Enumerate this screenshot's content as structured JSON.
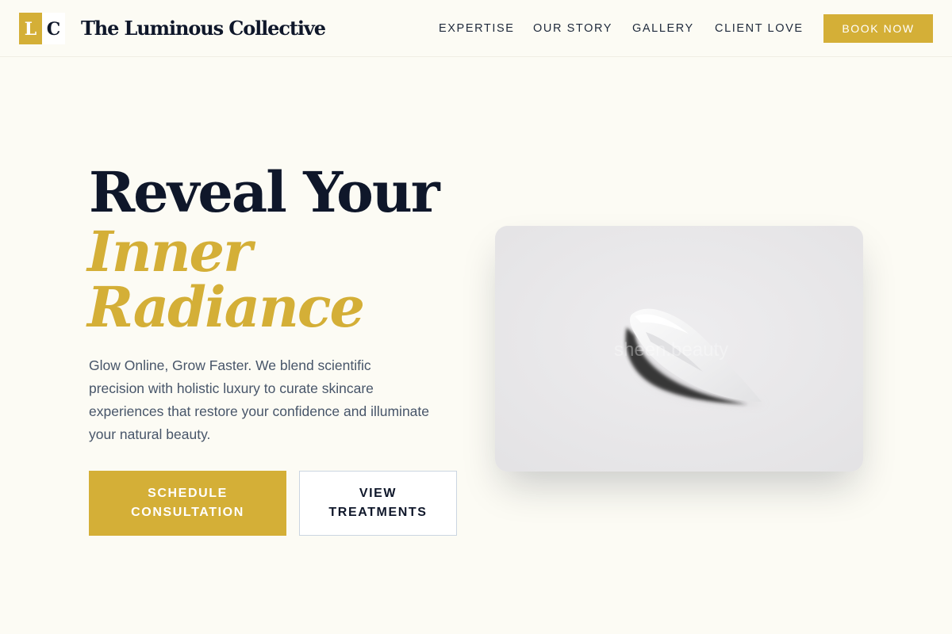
{
  "header": {
    "logo_left_letter": "L",
    "logo_right_letter": "C",
    "brand_name": "The Luminous Collective",
    "nav": {
      "expertise": "EXPERTISE",
      "our_story": "OUR STORY",
      "gallery": "GALLERY",
      "client_love": "CLIENT LOVE"
    },
    "book_now": "BOOK NOW"
  },
  "hero": {
    "title_line1": "Reveal Your",
    "title_line2": "Inner",
    "title_line3": "Radiance",
    "description": "Glow Online, Grow Faster. We blend scientific precision with holistic luxury to curate skincare experiences that restore your confidence and illuminate your natural beauty.",
    "primary_button_line1": "SCHEDULE",
    "primary_button_line2": "CONSULTATION",
    "secondary_button_line1": "VIEW",
    "secondary_button_line2": "TREATMENTS",
    "image_watermark": "sheen.beauty"
  },
  "colors": {
    "accent_gold": "#d4af37",
    "navy_text": "#0f172a",
    "page_background": "#fcfbf4",
    "body_text": "#475569"
  }
}
